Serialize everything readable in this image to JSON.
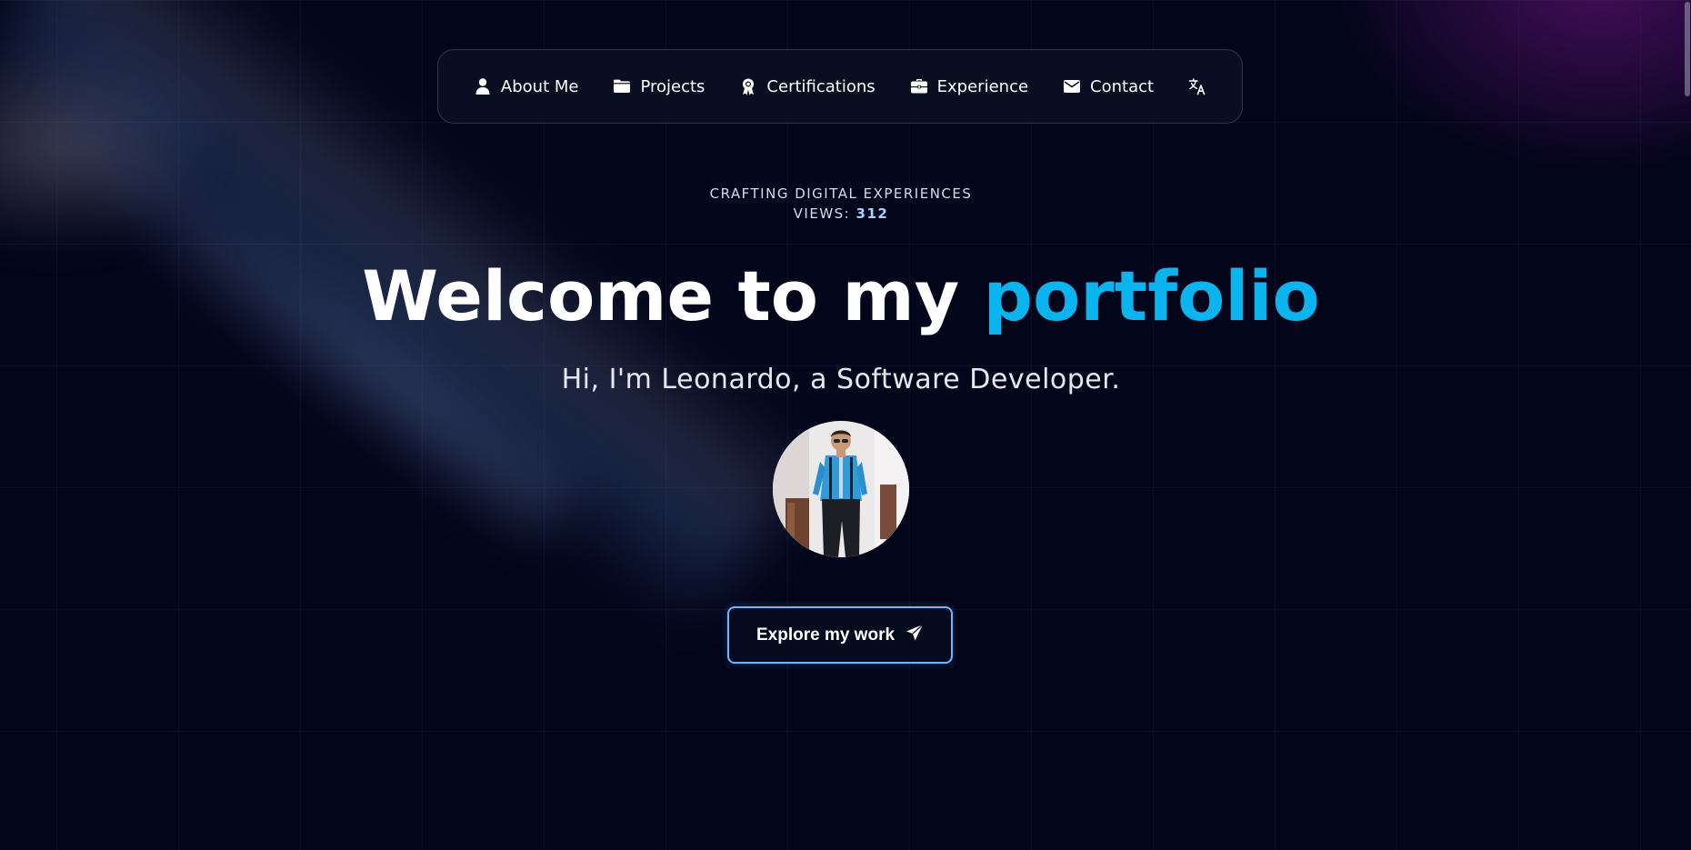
{
  "nav": {
    "items": [
      {
        "label": "About Me",
        "icon": "user-icon"
      },
      {
        "label": "Projects",
        "icon": "folder-icon"
      },
      {
        "label": "Certifications",
        "icon": "award-icon"
      },
      {
        "label": "Experience",
        "icon": "briefcase-icon"
      },
      {
        "label": "Contact",
        "icon": "envelope-icon"
      }
    ],
    "language_icon": "translate-icon"
  },
  "hero": {
    "tagline": "CRAFTING DIGITAL EXPERIENCES",
    "views_label": "VIEWS:",
    "views_count": "312",
    "headline_main": "Welcome to my ",
    "headline_accent": "portfolio",
    "subline": "Hi, I'm Leonardo, a Software Developer.",
    "cta_label": "Explore my work",
    "cta_icon": "paper-plane-icon"
  },
  "colors": {
    "background": "#03051a",
    "accent": "#0ab4ef",
    "button_border": "#6bb6ff"
  }
}
